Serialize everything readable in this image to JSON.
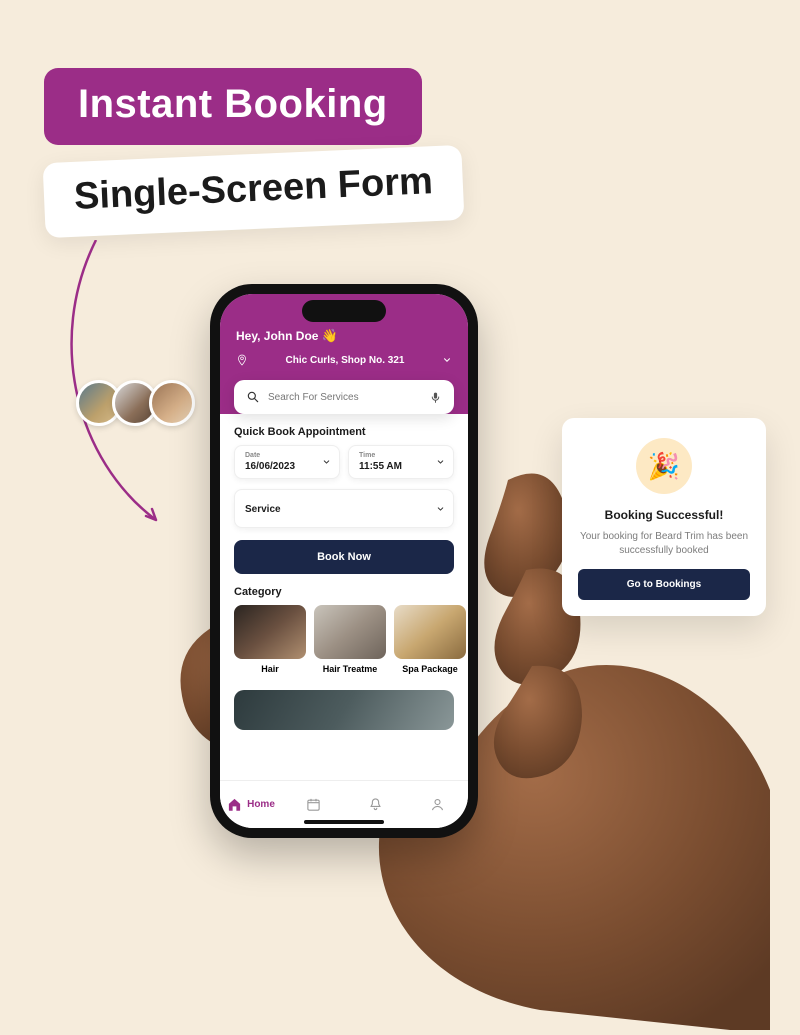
{
  "headline": "Instant Booking",
  "subheadline": "Single-Screen Form",
  "phone": {
    "greeting_prefix": "Hey, ",
    "user_name": "John Doe",
    "wave_emoji": "👋",
    "location": "Chic Curls, Shop No. 321",
    "search_placeholder": "Search For Services",
    "quick_book_title": "Quick Book Appointment",
    "date_label": "Date",
    "date_value": "16/06/2023",
    "time_label": "Time",
    "time_value": "11:55 AM",
    "service_label": "Service",
    "book_button": "Book Now",
    "category_title": "Category",
    "categories": [
      {
        "label": "Hair"
      },
      {
        "label": "Hair Treatme"
      },
      {
        "label": "Spa Package"
      }
    ],
    "nav": {
      "home": "Home"
    }
  },
  "success": {
    "title": "Booking Successful!",
    "message": "Your booking for Beard Trim has been successfully booked",
    "button": "Go to Bookings",
    "icon_emoji": "🎉"
  },
  "colors": {
    "brand": "#9b2d87",
    "navy": "#1b2748",
    "bg": "#f6ecdc"
  }
}
